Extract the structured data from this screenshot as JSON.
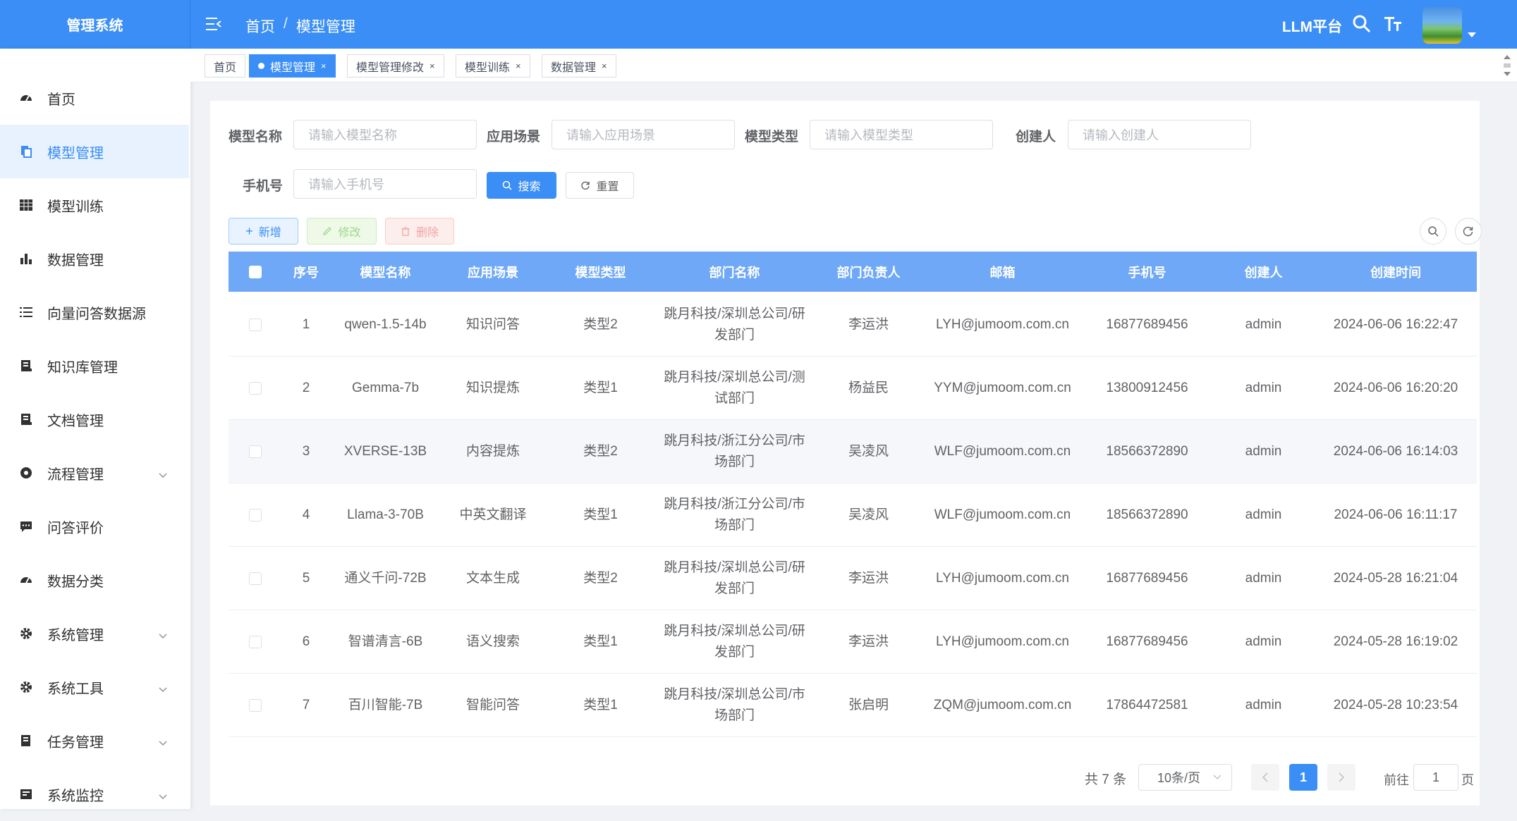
{
  "app": {
    "title": "管理系统",
    "platform": "LLM平台"
  },
  "breadcrumb": {
    "home": "首页",
    "sep": "/",
    "current": "模型管理"
  },
  "sidebar": {
    "items": [
      {
        "label": "首页",
        "icon": "dashboard-icon"
      },
      {
        "label": "模型管理",
        "icon": "copy-icon",
        "active": true
      },
      {
        "label": "模型训练",
        "icon": "grid-icon"
      },
      {
        "label": "数据管理",
        "icon": "bar-chart-icon"
      },
      {
        "label": "向量问答数据源",
        "icon": "list-icon"
      },
      {
        "label": "知识库管理",
        "icon": "book-icon"
      },
      {
        "label": "文档管理",
        "icon": "document-icon"
      },
      {
        "label": "流程管理",
        "icon": "flow-icon",
        "expandable": true
      },
      {
        "label": "问答评价",
        "icon": "chat-icon"
      },
      {
        "label": "数据分类",
        "icon": "dashboard-icon"
      },
      {
        "label": "系统管理",
        "icon": "gear-icon",
        "expandable": true
      },
      {
        "label": "系统工具",
        "icon": "gear-icon",
        "expandable": true
      },
      {
        "label": "任务管理",
        "icon": "task-icon",
        "expandable": true
      },
      {
        "label": "系统监控",
        "icon": "monitor-icon",
        "expandable": true
      }
    ]
  },
  "tags": [
    {
      "label": "首页",
      "active": false,
      "closable": false
    },
    {
      "label": "模型管理",
      "active": true,
      "closable": true
    },
    {
      "label": "模型管理修改",
      "active": false,
      "closable": true
    },
    {
      "label": "模型训练",
      "active": false,
      "closable": true
    },
    {
      "label": "数据管理",
      "active": false,
      "closable": true
    }
  ],
  "filters": {
    "model_name": {
      "label": "模型名称",
      "placeholder": "请输入模型名称"
    },
    "scene": {
      "label": "应用场景",
      "placeholder": "请输入应用场景"
    },
    "model_type": {
      "label": "模型类型",
      "placeholder": "请输入模型类型"
    },
    "creator": {
      "label": "创建人",
      "placeholder": "请输入创建人"
    },
    "phone": {
      "label": "手机号",
      "placeholder": "请输入手机号"
    },
    "search_btn": "搜索",
    "reset_btn": "重置"
  },
  "toolbar": {
    "add": "新增",
    "edit": "修改",
    "delete": "删除"
  },
  "table": {
    "columns": [
      "序号",
      "模型名称",
      "应用场景",
      "模型类型",
      "部门名称",
      "部门负责人",
      "邮箱",
      "手机号",
      "创建人",
      "创建时间"
    ],
    "rows": [
      {
        "no": "1",
        "name": "qwen-1.5-14b",
        "scene": "知识问答",
        "type": "类型2",
        "dept1": "跳月科技/深圳总公司/研",
        "dept2": "发部门",
        "leader": "李运洪",
        "email": "LYH@jumoom.com.cn",
        "phone": "16877689456",
        "creator": "admin",
        "time": "2024-06-06 16:22:47"
      },
      {
        "no": "2",
        "name": "Gemma-7b",
        "scene": "知识提炼",
        "type": "类型1",
        "dept1": "跳月科技/深圳总公司/测",
        "dept2": "试部门",
        "leader": "杨益民",
        "email": "YYM@jumoom.com.cn",
        "phone": "13800912456",
        "creator": "admin",
        "time": "2024-06-06 16:20:20"
      },
      {
        "no": "3",
        "name": "XVERSE-13B",
        "scene": "内容提炼",
        "type": "类型2",
        "dept1": "跳月科技/浙江分公司/市",
        "dept2": "场部门",
        "leader": "吴凌风",
        "email": "WLF@jumoom.com.cn",
        "phone": "18566372890",
        "creator": "admin",
        "time": "2024-06-06 16:14:03"
      },
      {
        "no": "4",
        "name": "Llama-3-70B",
        "scene": "中英文翻译",
        "type": "类型1",
        "dept1": "跳月科技/浙江分公司/市",
        "dept2": "场部门",
        "leader": "吴凌风",
        "email": "WLF@jumoom.com.cn",
        "phone": "18566372890",
        "creator": "admin",
        "time": "2024-06-06 16:11:17"
      },
      {
        "no": "5",
        "name": "通义千问-72B",
        "scene": "文本生成",
        "type": "类型2",
        "dept1": "跳月科技/深圳总公司/研",
        "dept2": "发部门",
        "leader": "李运洪",
        "email": "LYH@jumoom.com.cn",
        "phone": "16877689456",
        "creator": "admin",
        "time": "2024-05-28 16:21:04"
      },
      {
        "no": "6",
        "name": "智谱清言-6B",
        "scene": "语义搜索",
        "type": "类型1",
        "dept1": "跳月科技/深圳总公司/研",
        "dept2": "发部门",
        "leader": "李运洪",
        "email": "LYH@jumoom.com.cn",
        "phone": "16877689456",
        "creator": "admin",
        "time": "2024-05-28 16:19:02"
      },
      {
        "no": "7",
        "name": "百川智能-7B",
        "scene": "智能问答",
        "type": "类型1",
        "dept1": "跳月科技/深圳总公司/市",
        "dept2": "场部门",
        "leader": "张启明",
        "email": "ZQM@jumoom.com.cn",
        "phone": "17864472581",
        "creator": "admin",
        "time": "2024-05-28 10:23:54"
      }
    ]
  },
  "pagination": {
    "total": "共 7 条",
    "page_size": "10条/页",
    "current": "1",
    "goto": "前往",
    "goto_value": "1",
    "page_unit": "页"
  },
  "colors": {
    "primary": "#3a8ef6",
    "header_bg": "#3a8ef6",
    "table_head": "#6ea8f7"
  }
}
